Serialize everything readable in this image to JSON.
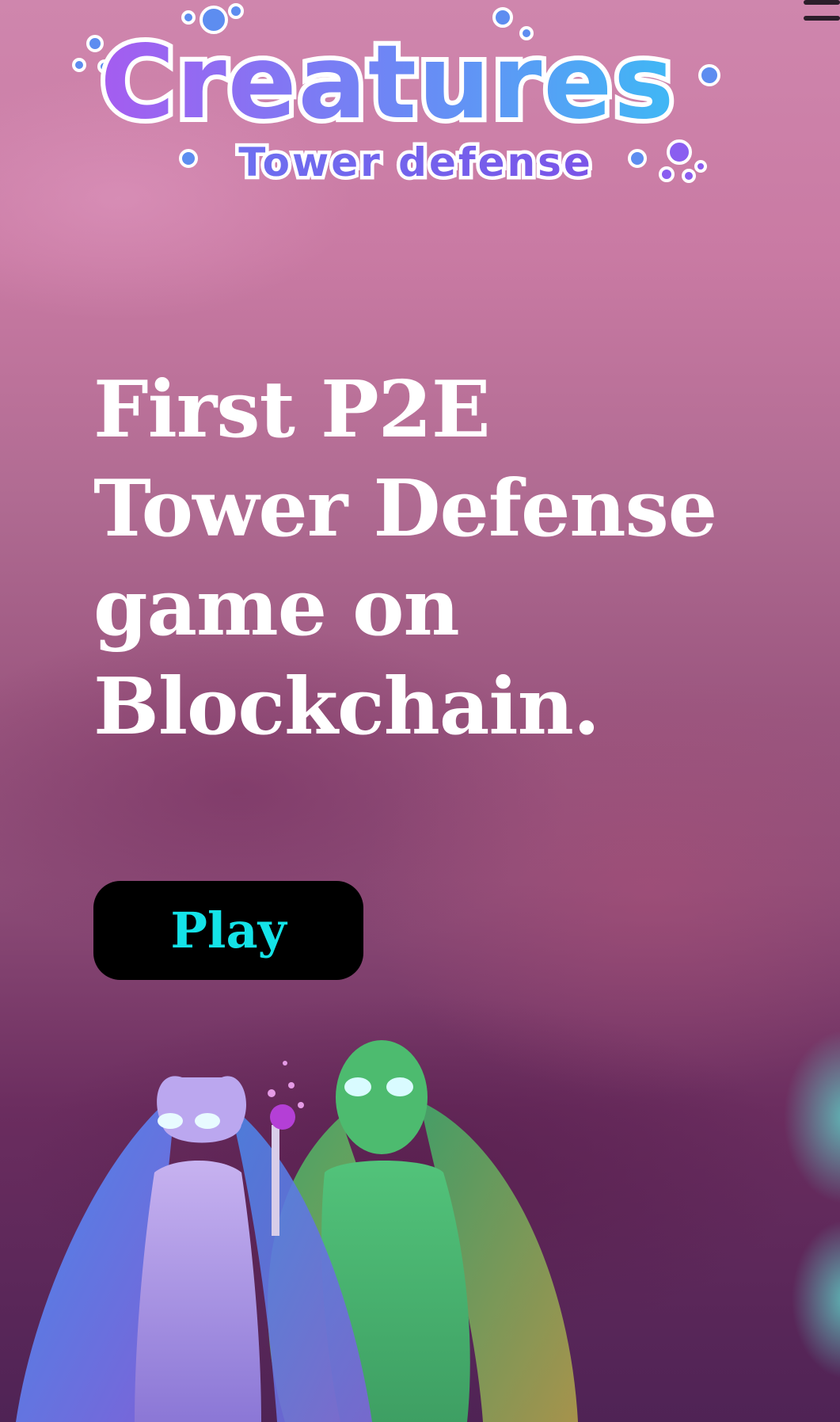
{
  "header": {
    "menu_icon": "hamburger-menu-icon"
  },
  "logo": {
    "title": "Creatures",
    "subtitle": "Tower defense"
  },
  "hero": {
    "title_lines": [
      "First P2E",
      "Tower Defense",
      "game on",
      "Blockchain."
    ],
    "play_label": "Play"
  },
  "colors": {
    "play_text": "#14e3e8",
    "play_bg": "#000000",
    "logo_gradient_start": "#a55cf0",
    "logo_gradient_end": "#3fb8f5"
  }
}
